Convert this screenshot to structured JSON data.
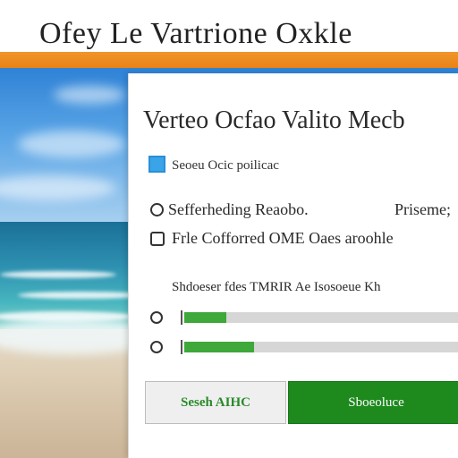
{
  "header": {
    "title": "Ofey Le  Vartrione Oxkle"
  },
  "theme": {
    "accent": "#e98218",
    "primary_green": "#1e8a1e",
    "checkbox_blue": "#3aa4e8"
  },
  "panel": {
    "title": "Verteo Ocfao Valito Mecb",
    "checkbox_label": "Seoeu Ocic poilicac",
    "options": [
      {
        "label": "Sefferheding Reaobo.",
        "extra": "Priseme;",
        "control": "radio"
      },
      {
        "label": "Frle Cofforred OME Oaes aroohle",
        "extra": "",
        "control": "square"
      }
    ],
    "section_label": "Shdoeser fdes TMRIR Ae Isosoeue Kh",
    "progress": [
      {
        "value": 0.15
      },
      {
        "value": 0.25
      }
    ],
    "buttons": {
      "secondary": "Seseh AIHC",
      "primary": "Sboeoluce"
    }
  }
}
